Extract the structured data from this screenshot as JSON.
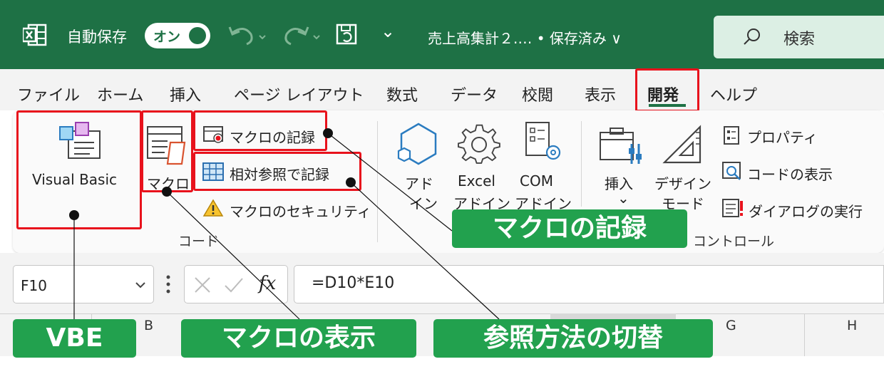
{
  "titlebar": {
    "autosave_label": "自動保存",
    "toggle_label": "オン",
    "qat_more": "⌄",
    "doc_title": "売上高集計２.… • 保存済み ∨",
    "search_placeholder": "検索"
  },
  "menu": {
    "items": [
      "ファイル",
      "ホーム",
      "挿入",
      "ページ レイアウト",
      "数式",
      "データ",
      "校閲",
      "表示",
      "開発",
      "ヘルプ"
    ]
  },
  "ribbon": {
    "visual_basic": "Visual Basic",
    "macro": "マクロ",
    "record_macro": "マクロの記録",
    "relative_ref": "相対参照で記録",
    "macro_security": "マクロのセキュリティ",
    "group_code": "コード",
    "addin_line1": "アド",
    "addin_line2": "イン",
    "excel_addin_line1": "Excel",
    "excel_addin_line2": "アドイン",
    "com_addin_line1": "COM",
    "com_addin_line2": "アドイン",
    "insert_label": "挿入",
    "insert_chevron": "⌄",
    "design_line1": "デザイン",
    "design_line2": "モード",
    "properties": "プロパティ",
    "view_code": "コードの表示",
    "run_dialog": "ダイアログの実行",
    "group_controls": "コントロール"
  },
  "formula": {
    "name_box": "F10",
    "fx": "fx",
    "formula": "=D10*E10"
  },
  "columns": [
    "B",
    "G",
    "H"
  ],
  "callouts": {
    "record": "マクロの記録",
    "vbe": "VBE",
    "macro_view": "マクロの表示",
    "ref_toggle": "参照方法の切替"
  },
  "colors": {
    "excel_green": "#1e7145",
    "callout_green": "#22a14e",
    "highlight_red": "#e8121c"
  }
}
